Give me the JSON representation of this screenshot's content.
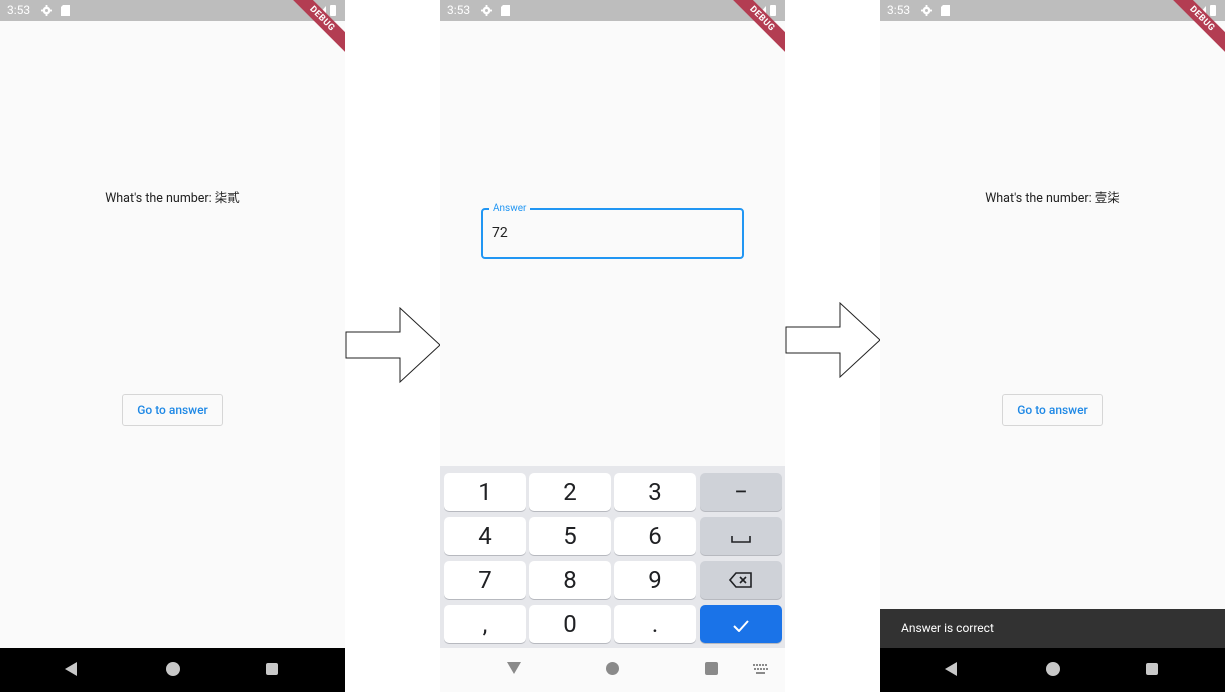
{
  "status_time": "3:53",
  "debug_label": "DEBUG",
  "screen1": {
    "question": "What's the number: 柒貳",
    "button_label": "Go to answer"
  },
  "screen2": {
    "field_label": "Answer",
    "field_value": "72",
    "keyboard_keys": [
      "1",
      "2",
      "3",
      "−",
      "4",
      "5",
      "6",
      "␣",
      "7",
      "8",
      "9",
      "⌫",
      ",",
      "0",
      ".",
      "✓"
    ]
  },
  "screen3": {
    "question": "What's the number: 壹柒",
    "button_label": "Go to answer",
    "snackbar": "Answer is correct"
  },
  "colors": {
    "accent": "#2196f3",
    "button_text": "#1e88e5",
    "debug_ribbon": "#b33d52",
    "done_key": "#1a73e8",
    "snackbar": "#323232"
  }
}
